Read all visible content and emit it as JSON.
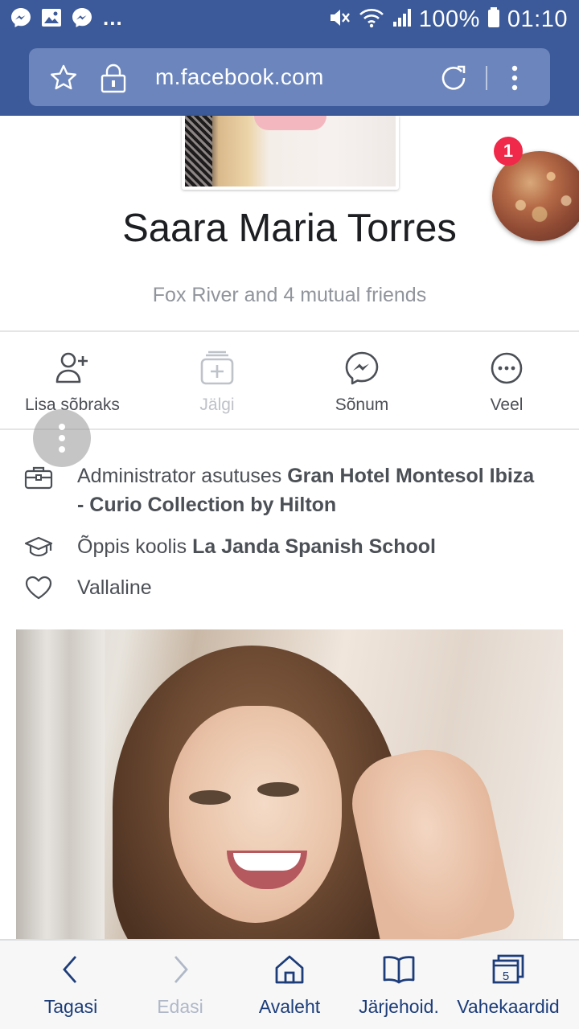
{
  "status_bar": {
    "battery": "100%",
    "time": "01:10",
    "overflow": "..."
  },
  "browser": {
    "url": "m.facebook.com"
  },
  "chat_head": {
    "badge_count": "1"
  },
  "profile": {
    "name": "Saara Maria Torres",
    "mutual": "Fox River and 4 mutual friends"
  },
  "actions": [
    {
      "label": "Lisa sõbraks",
      "icon": "add-friend-icon",
      "enabled": true
    },
    {
      "label": "Jälgi",
      "icon": "follow-icon",
      "enabled": false
    },
    {
      "label": "Sõnum",
      "icon": "messenger-icon",
      "enabled": true
    },
    {
      "label": "Veel",
      "icon": "more-icon",
      "enabled": true
    }
  ],
  "intro": {
    "work_prefix": "Administrator asutuses ",
    "work_place": "Gran Hotel Montesol Ibiza - Curio Collection by Hilton",
    "school_prefix": "Õppis koolis ",
    "school_name": "La Janda Spanish School",
    "relationship": "Vallaline"
  },
  "bottom_nav": {
    "back": "Tagasi",
    "forward": "Edasi",
    "home": "Avaleht",
    "bookmarks": "Järjehoid.",
    "tabs": "Vahekaardid",
    "tabs_count": "5"
  },
  "colors": {
    "facebook_blue": "#3c5a99",
    "url_box": "#6c86bd",
    "badge_red": "#f02849",
    "nav_text": "#1d3d7a"
  }
}
